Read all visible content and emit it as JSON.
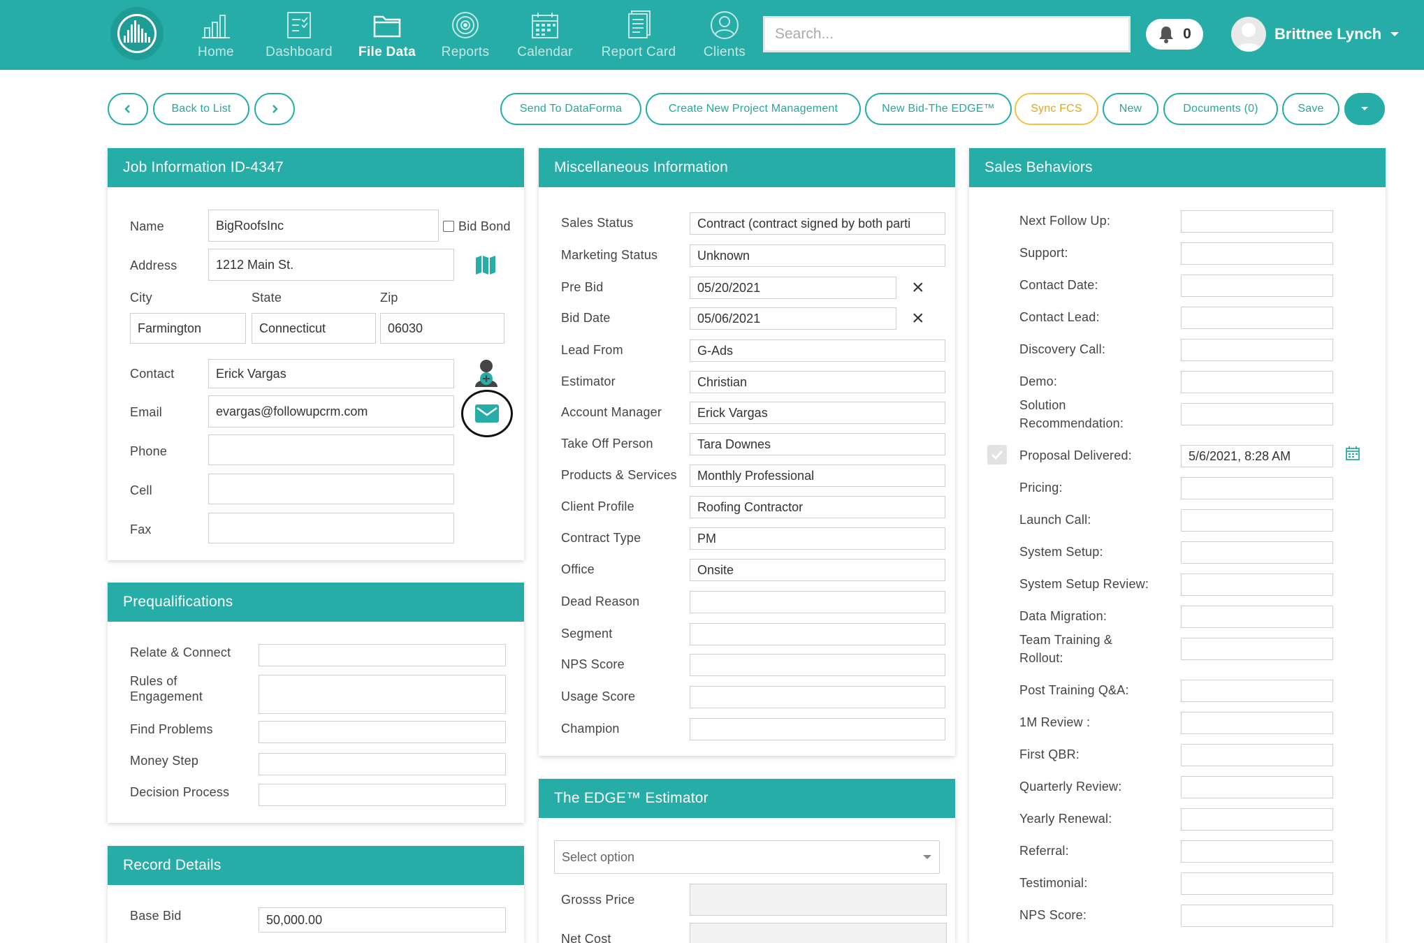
{
  "nav": {
    "items": [
      {
        "label": "Home",
        "icon": "bar-chart-icon"
      },
      {
        "label": "Dashboard",
        "icon": "checklist-icon"
      },
      {
        "label": "File Data",
        "icon": "folder-icon"
      },
      {
        "label": "Reports",
        "icon": "target-icon"
      },
      {
        "label": "Calendar",
        "icon": "calendar-icon"
      },
      {
        "label": "Report Card",
        "icon": "document-icon"
      },
      {
        "label": "Clients",
        "icon": "user-icon"
      }
    ],
    "active": "File Data",
    "search_placeholder": "Search...",
    "notification_count": "0",
    "user_name": "Brittnee Lynch"
  },
  "toolbar": {
    "back_to_list": "Back to List",
    "send_to_dataforma": "Send To DataForma",
    "create_project": "Create New Project Management",
    "new_bid": "New Bid-The EDGE™",
    "sync_fcs": "Sync FCS",
    "new": "New",
    "documents": "Documents (0)",
    "save": "Save"
  },
  "job": {
    "title": "Job Information ID-4347",
    "name_label": "Name",
    "name": "BigRoofsInc",
    "bid_bond_label": "Bid Bond",
    "address_label": "Address",
    "address": "1212 Main St.",
    "city_label": "City",
    "state_label": "State",
    "zip_label": "Zip",
    "city": "Farmington",
    "state": "Connecticut",
    "zip": "06030",
    "contact_label": "Contact",
    "contact": "Erick Vargas",
    "email_label": "Email",
    "email": "evargas@followupcrm.com",
    "phone_label": "Phone",
    "cell_label": "Cell",
    "fax_label": "Fax"
  },
  "prequal": {
    "title": "Prequalifications",
    "fields": [
      "Relate & Connect",
      "Rules of Engagement",
      "Find Problems",
      "Money Step",
      "Decision Process"
    ]
  },
  "record": {
    "title": "Record Details",
    "base_bid_label": "Base Bid",
    "base_bid": "50,000.00"
  },
  "misc": {
    "title": "Miscellaneous Information",
    "fields": [
      {
        "label": "Sales Status",
        "value": "Contract (contract signed by both parti"
      },
      {
        "label": "Marketing Status",
        "value": "Unknown"
      },
      {
        "label": "Pre Bid",
        "value": "05/20/2021"
      },
      {
        "label": "Bid Date",
        "value": "05/06/2021"
      },
      {
        "label": "Lead From",
        "value": "G-Ads"
      },
      {
        "label": "Estimator",
        "value": "Christian"
      },
      {
        "label": "Account Manager",
        "value": "Erick Vargas"
      },
      {
        "label": "Take Off Person",
        "value": "Tara Downes"
      },
      {
        "label": "Products & Services",
        "value": "Monthly Professional"
      },
      {
        "label": "Client Profile",
        "value": "Roofing Contractor"
      },
      {
        "label": "Contract Type",
        "value": "PM"
      },
      {
        "label": "Office",
        "value": "Onsite"
      },
      {
        "label": "Dead Reason",
        "value": ""
      },
      {
        "label": "Segment",
        "value": ""
      },
      {
        "label": "NPS Score",
        "value": ""
      },
      {
        "label": "Usage Score",
        "value": ""
      },
      {
        "label": "Champion",
        "value": ""
      }
    ]
  },
  "edge": {
    "title": "The EDGE™ Estimator",
    "select_placeholder": "Select option",
    "gross_price_label": "Grosss Price",
    "net_cost_label": "Net Cost"
  },
  "sales": {
    "title": "Sales Behaviors",
    "fields": [
      {
        "label": "Next Follow Up:",
        "value": ""
      },
      {
        "label": "Support:",
        "value": ""
      },
      {
        "label": "Contact Date:",
        "value": ""
      },
      {
        "label": "Contact Lead:",
        "value": ""
      },
      {
        "label": "Discovery Call:",
        "value": ""
      },
      {
        "label": "Demo:",
        "value": ""
      },
      {
        "label": "Solution Recommendation:",
        "value": ""
      },
      {
        "label": "Proposal Delivered:",
        "value": "5/6/2021, 8:28 AM"
      },
      {
        "label": "Pricing:",
        "value": ""
      },
      {
        "label": "Launch Call:",
        "value": ""
      },
      {
        "label": "System Setup:",
        "value": ""
      },
      {
        "label": "System Setup Review:",
        "value": ""
      },
      {
        "label": "Data Migration:",
        "value": ""
      },
      {
        "label": "Team Training & Rollout:",
        "value": ""
      },
      {
        "label": "Post Training Q&A:",
        "value": ""
      },
      {
        "label": "1M Review :",
        "value": ""
      },
      {
        "label": "First QBR:",
        "value": ""
      },
      {
        "label": "Quarterly Review:",
        "value": ""
      },
      {
        "label": "Yearly Renewal:",
        "value": ""
      },
      {
        "label": "Referral:",
        "value": ""
      },
      {
        "label": "Testimonial:",
        "value": ""
      },
      {
        "label": "NPS Score:",
        "value": ""
      }
    ]
  },
  "colors": {
    "primary": "#26ada7",
    "accent_yellow": "#f2c24a"
  }
}
